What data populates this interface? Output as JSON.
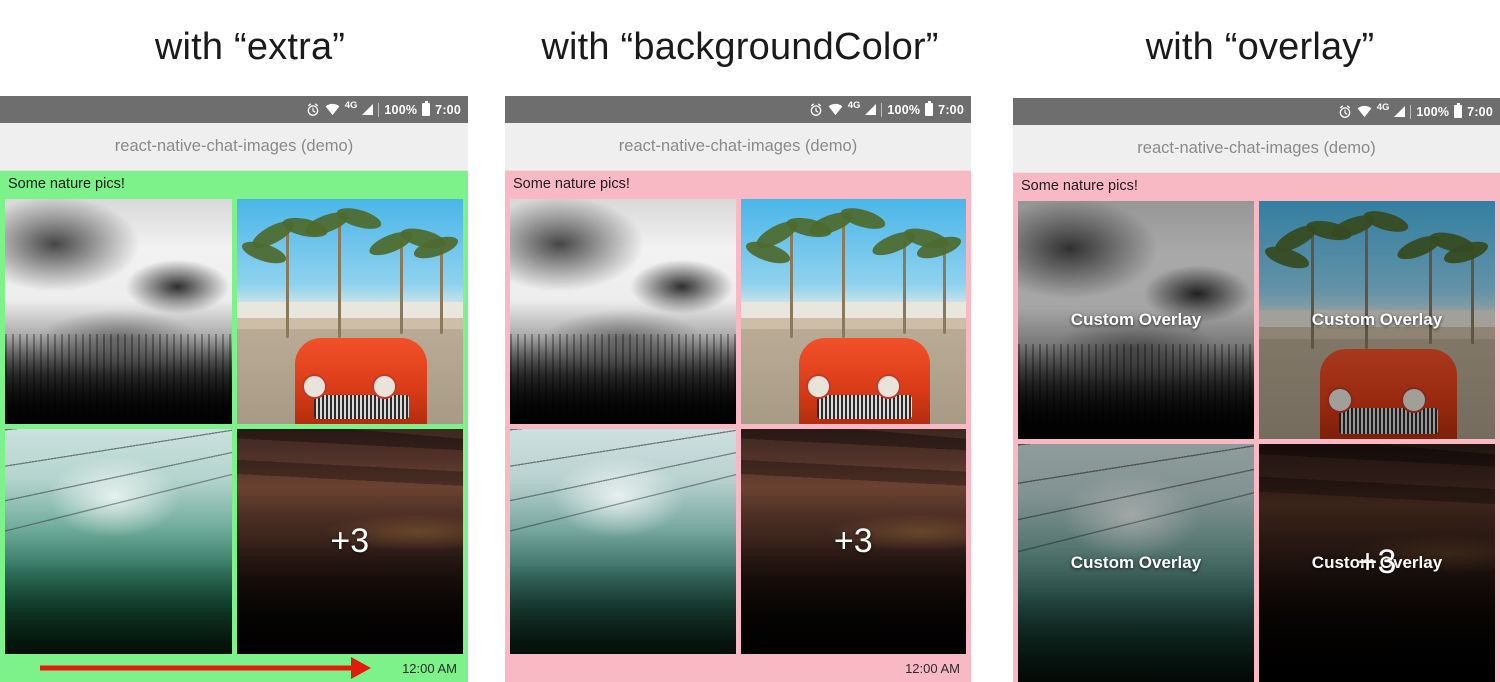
{
  "headings": {
    "extra": "with “extra”",
    "background_color": "with “backgroundColor”",
    "overlay": "with “overlay”"
  },
  "statusbar": {
    "alarm_icon": "alarm-clock-icon",
    "wifi_icon": "wifi-icon",
    "network": "4G",
    "signal_icon": "signal-bars-icon",
    "battery_percent": "100%",
    "battery_icon": "battery-icon",
    "clock": "7:00"
  },
  "appbar": {
    "title": "react-native-chat-images (demo)"
  },
  "panels": [
    {
      "id": "extra",
      "bubble_color": "#7ef28a",
      "message": "Some nature pics!",
      "timestamp": "12:00 AM",
      "show_timestamp": true,
      "annotation": "red-arrow",
      "images": [
        {
          "alt": "misty-forest",
          "overlay": null,
          "badge": null
        },
        {
          "alt": "red-car-palms",
          "overlay": null,
          "badge": null
        },
        {
          "alt": "teal-valley-powerlines",
          "overlay": null,
          "badge": null
        },
        {
          "alt": "dark-dusk-mountains",
          "overlay": null,
          "badge": "+3"
        }
      ]
    },
    {
      "id": "backgroundColor",
      "bubble_color": "#f9b9c4",
      "message": "Some nature pics!",
      "timestamp": "12:00 AM",
      "show_timestamp": true,
      "annotation": null,
      "images": [
        {
          "alt": "misty-forest",
          "overlay": null,
          "badge": null
        },
        {
          "alt": "red-car-palms",
          "overlay": null,
          "badge": null
        },
        {
          "alt": "teal-valley-powerlines",
          "overlay": null,
          "badge": null
        },
        {
          "alt": "dark-dusk-mountains",
          "overlay": null,
          "badge": "+3"
        }
      ]
    },
    {
      "id": "overlay",
      "bubble_color": "#f9b9c4",
      "message": "Some nature pics!",
      "timestamp": "",
      "show_timestamp": false,
      "annotation": null,
      "images": [
        {
          "alt": "misty-forest",
          "overlay": "Custom Overlay",
          "badge": null
        },
        {
          "alt": "red-car-palms",
          "overlay": "Custom Overlay",
          "badge": null
        },
        {
          "alt": "teal-valley-powerlines",
          "overlay": "Custom Overlay",
          "badge": null
        },
        {
          "alt": "dark-dusk-mountains",
          "overlay": "Custom Overlay",
          "badge": "+3"
        }
      ]
    }
  ],
  "colors": {
    "statusbar": "#6e6e6e",
    "appbar": "#efefef",
    "appbar_text": "#8a8a8a",
    "green_bubble": "#7ef28a",
    "pink_bubble": "#f9b9c4",
    "arrow": "#e21b0c"
  }
}
